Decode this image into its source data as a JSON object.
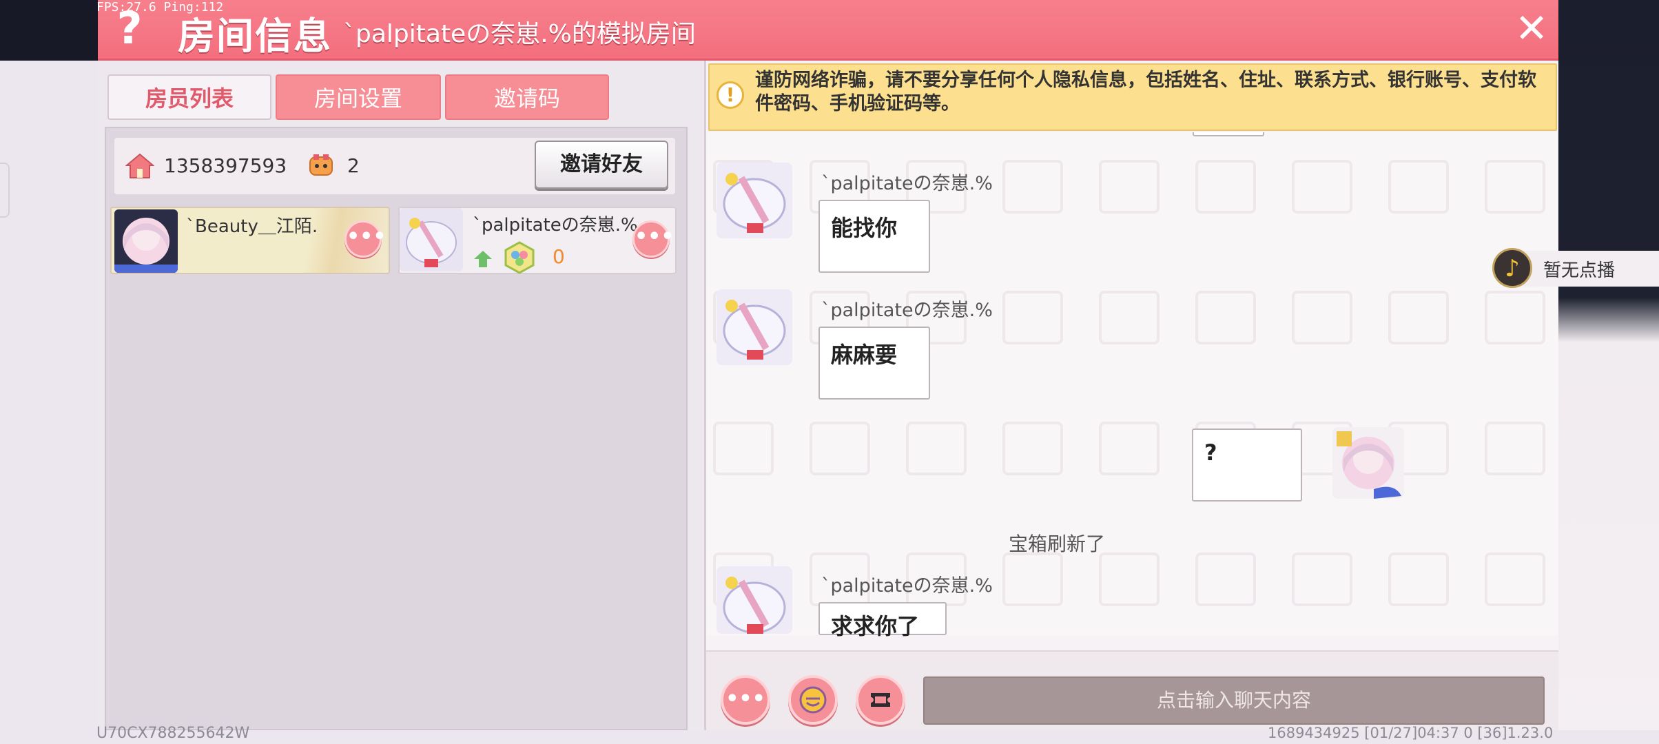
{
  "overlay": {
    "fps_text": "FPS:27.6  Ping:112"
  },
  "header": {
    "help_icon": "question-icon",
    "title": "房间信息",
    "room_name": "`palpitateの奈崽.%的模拟房间",
    "close_icon": "close-icon"
  },
  "tabs": [
    {
      "label": "房员列表",
      "active": true
    },
    {
      "label": "房间设置",
      "active": false
    },
    {
      "label": "邀请码",
      "active": false
    }
  ],
  "room_info": {
    "room_id": "1358397593",
    "player_count": "2",
    "invite_friends_label": "邀请好友"
  },
  "members": [
    {
      "name": "`Beauty＿江陌.",
      "more_label": "•••"
    },
    {
      "name": "`palpitateの奈崽.%",
      "score": "0",
      "more_label": "•••"
    }
  ],
  "warning": {
    "icon_text": "!",
    "text": "谨防网络诈骗，请不要分享任何个人隐私信息，包括姓名、住址、联系方式、银行账号、支付软件密码、手机验证码等。"
  },
  "chat": {
    "messages": [
      {
        "sender": "`palpitateの奈崽.%",
        "text": "能找你",
        "side": "left"
      },
      {
        "sender": "`palpitateの奈崽.%",
        "text": "麻麻要",
        "side": "left"
      },
      {
        "sender": "",
        "text": "?",
        "side": "right"
      },
      {
        "sender": "`palpitateの奈崽.%",
        "text": "求求你了",
        "side": "left"
      }
    ],
    "system_message": "宝箱刷新了"
  },
  "chat_bar": {
    "more_label": "•••",
    "emoji_icon": "emoji-icon",
    "sticker_icon": "ticket-icon",
    "input_placeholder": "点击输入聊天内容"
  },
  "now_playing": {
    "label": "暂无点播",
    "icon": "music-note-icon"
  },
  "footer": {
    "uid": "U70CX788255642W",
    "ids": "1689434925    [01/27]04:37 0    [36]1.23.0"
  },
  "colors": {
    "header": "#f3707f",
    "tab_inactive": "#f78e96",
    "warning_bg": "#fde08f",
    "input_bg": "#a79697",
    "score": "#f18a2a"
  }
}
